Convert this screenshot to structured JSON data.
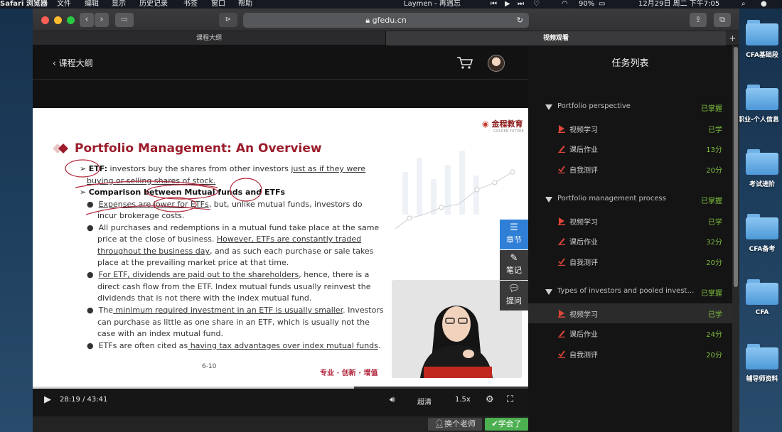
{
  "menubar": {
    "app": "Safari 浏览器",
    "items": [
      "文件",
      "编辑",
      "显示",
      "历史记录",
      "书签",
      "窗口",
      "帮助"
    ],
    "now_playing": "Laymen - 再遇忘",
    "battery": "90%",
    "clock": "12月29日 周二 下午7:05"
  },
  "browser": {
    "url": "gfedu.cn",
    "tabs": [
      "课程大纲",
      "视频观看"
    ],
    "new_tab": "+"
  },
  "course": {
    "back_label": "课程大纲"
  },
  "slide": {
    "logo": "金程教育",
    "logo_sub": "GOLDEN FUTURE",
    "title": "Portfolio Management: An Overview",
    "lines": [
      {
        "prefix": "ETF:",
        "text": " investors buy the shares from other investors ",
        "u": "just as if they were"
      },
      {
        "text": "",
        "u": "buying or selling shares of stock."
      },
      {
        "prefix": "Comparison between Mutual funds and ETFs",
        "text": "",
        "u": ""
      },
      {
        "u": "Expenses are lower for ETFs",
        "text": ", but, unlike mutual funds, investors do"
      },
      {
        "text": "incur brokerage costs."
      },
      {
        "text": "All purchases and redemptions in a mutual fund take place at the same"
      },
      {
        "text": "price at the close of business. ",
        "u": "However, ETFs are constantly traded"
      },
      {
        "u": "throughout the business day",
        "text": ", and as such each purchase or sale takes"
      },
      {
        "text": "place at the prevailing market price at that time."
      },
      {
        "u": "For ETF, dividends are paid out to the shareholders",
        "text": ", hence, there is a"
      },
      {
        "text": "direct cash flow from the ETF. Index mutual funds usually reinvest the"
      },
      {
        "text": "dividends that is not there with the index mutual fund."
      },
      {
        "text": "The",
        "u": " minimum required investment in an ETF is usually smaller",
        "text2": ". Investors"
      },
      {
        "text": "can purchase as little as one share in an ETF, which is usually not the"
      },
      {
        "text": "case with an index mutual fund."
      },
      {
        "text": "ETFs are often cited as",
        "u": " having tax advantages over index mutual funds",
        "text2": "."
      }
    ],
    "page": "6-10",
    "footer": "专业 · 创新 · 增值"
  },
  "side_buttons": [
    {
      "label": "章节",
      "icon": "list-icon",
      "color": "#2f7fd6"
    },
    {
      "label": "笔记",
      "icon": "pencil-icon",
      "color": "#3a3a3a"
    },
    {
      "label": "提问",
      "icon": "chat-icon",
      "color": "#3a3a3a"
    }
  ],
  "player": {
    "time": "28:19 / 43:41",
    "progress": 0.648,
    "quality": "超清",
    "speed": "1.5x"
  },
  "bottom": {
    "switch_teacher": "换个老师",
    "learned": "学会了"
  },
  "tasks": {
    "title": "任务列表",
    "sections": [
      {
        "name": "Portfolio perspective",
        "status": "已掌握",
        "items": [
          {
            "name": "视频学习",
            "status": "已学",
            "type": "video"
          },
          {
            "name": "课后作业",
            "status": "13分",
            "type": "homework"
          },
          {
            "name": "自我测评",
            "status": "20分",
            "type": "test"
          }
        ]
      },
      {
        "name": "Portfolio management process",
        "status": "已掌握",
        "items": [
          {
            "name": "视频学习",
            "status": "已学",
            "type": "video"
          },
          {
            "name": "课后作业",
            "status": "32分",
            "type": "homework"
          },
          {
            "name": "自我测评",
            "status": "20分",
            "type": "test"
          }
        ]
      },
      {
        "name": "Types of investors and pooled invest…",
        "status": "已掌握",
        "items": [
          {
            "name": "视频学习",
            "status": "已学",
            "type": "video",
            "active": true
          },
          {
            "name": "课后作业",
            "status": "24分",
            "type": "homework"
          },
          {
            "name": "自我测评",
            "status": "20分",
            "type": "test"
          }
        ]
      }
    ]
  },
  "desktop_folders": [
    "CFA基础段",
    "职业-个人信息",
    "考试进阶",
    "CFA备考",
    "CFA",
    "辅导师资料"
  ],
  "colors": {
    "accent_green": "#7fbf3f",
    "accent_blue": "#2f7fd6",
    "slide_title": "#9b1c2b"
  }
}
